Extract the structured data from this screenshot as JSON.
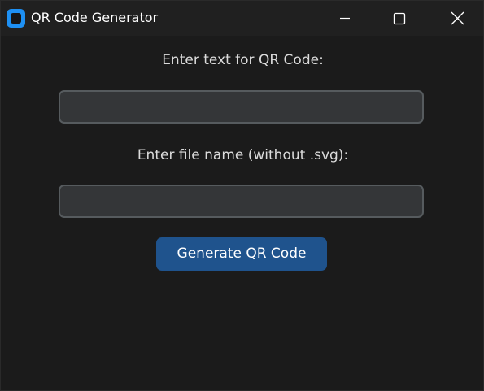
{
  "window": {
    "title": "QR Code Generator",
    "icon": "app-icon",
    "controls": [
      "minimize-icon",
      "maximize-icon",
      "close-icon"
    ]
  },
  "form": {
    "text_label": "Enter text for QR Code:",
    "text_value": "",
    "file_label": "Enter file name (without .svg):",
    "file_value": "",
    "generate_label": "Generate QR Code"
  },
  "colors": {
    "background": "#1b1b1b",
    "titlebar": "#202020",
    "field_bg": "#343638",
    "field_border": "#565b5e",
    "button": "#1f538d",
    "app_icon": "#1e90f3"
  }
}
